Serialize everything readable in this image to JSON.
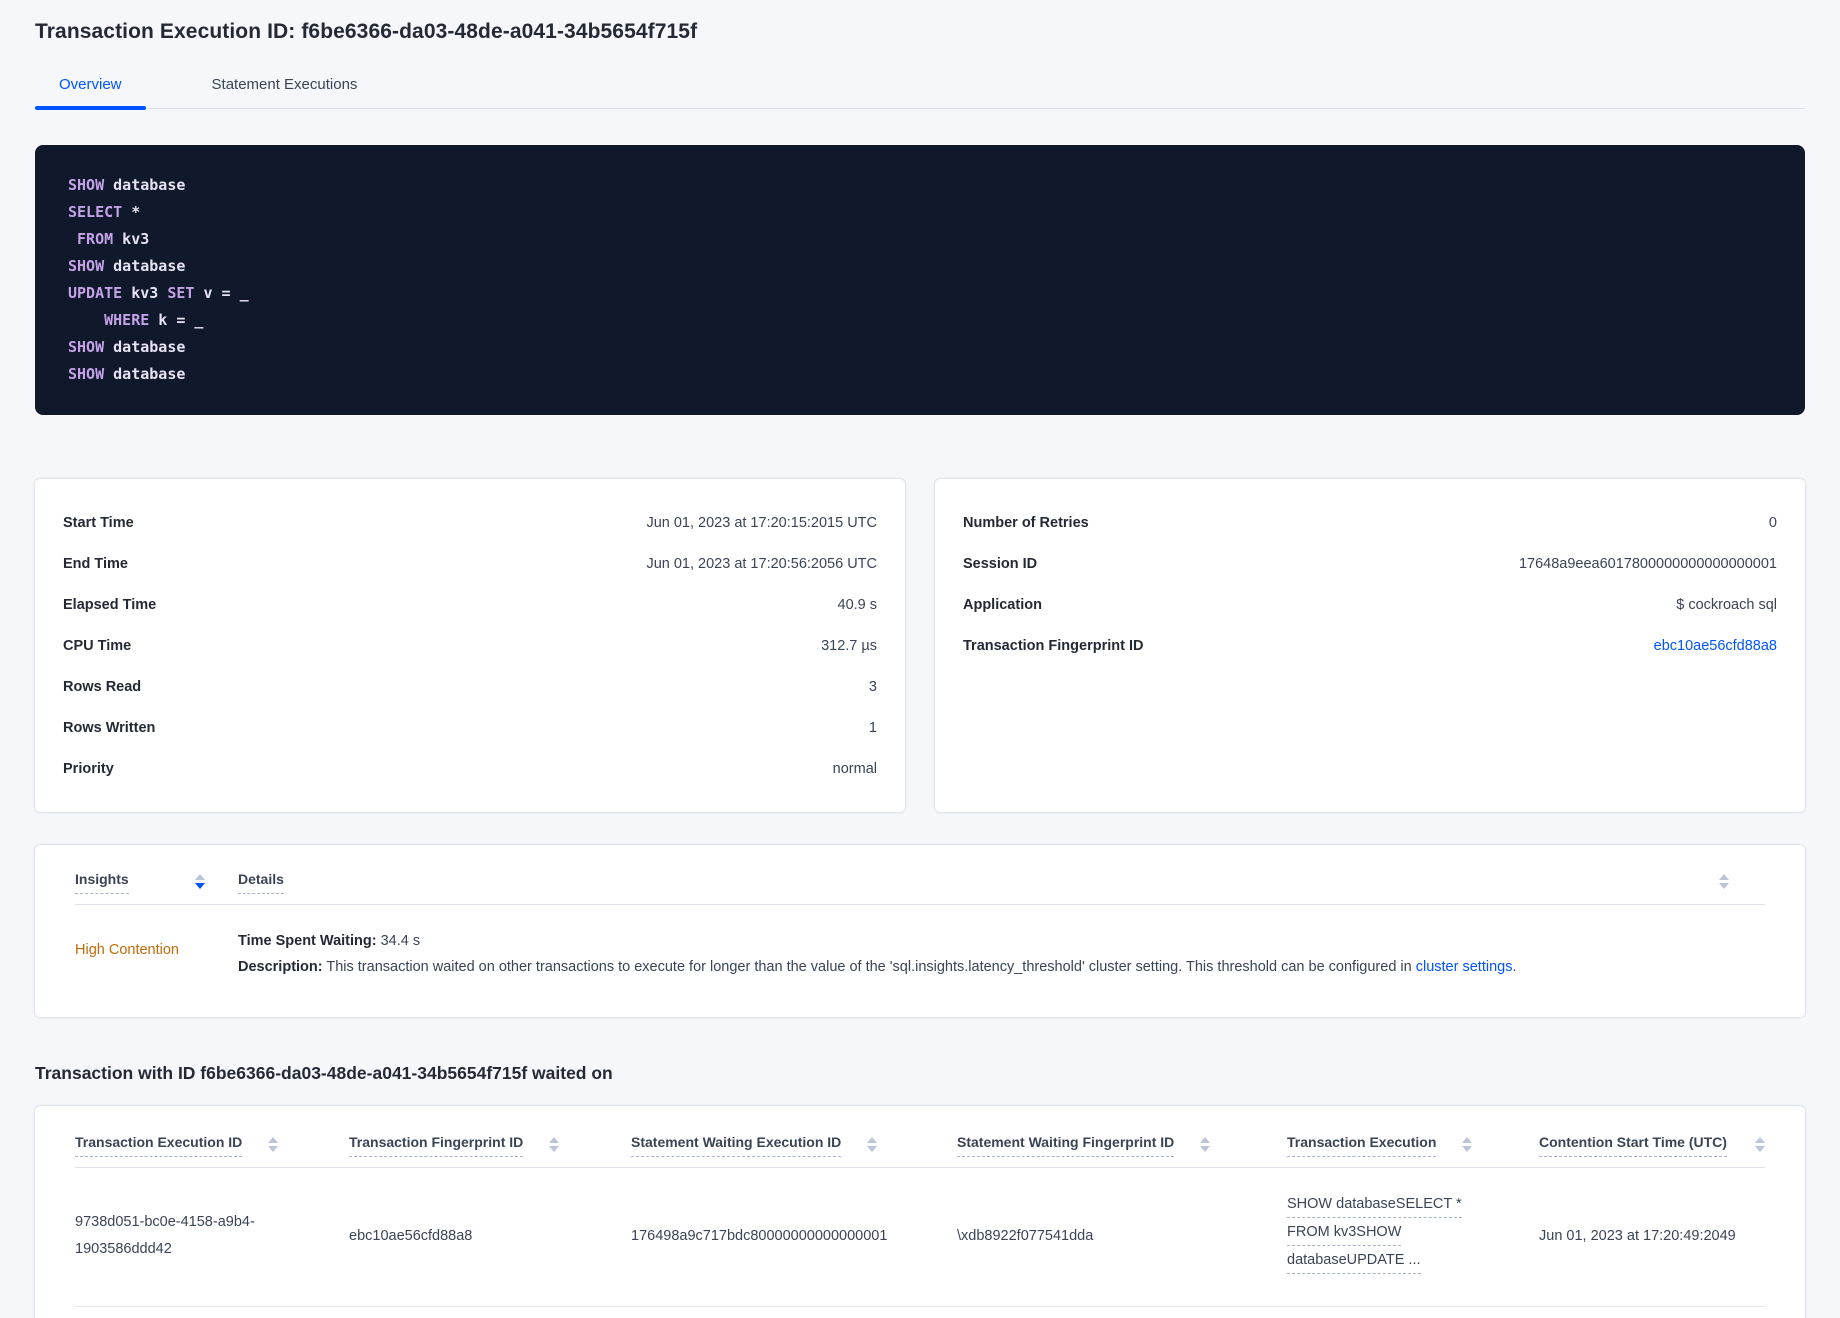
{
  "page": {
    "title": "Transaction Execution ID: f6be6366-da03-48de-a041-34b5654f715f",
    "background_color": "#f5f7fa",
    "accent_blue": "#0055ff",
    "contention_orange": "#bf6b09",
    "sql_box_background": "#10192c",
    "sql_keyword_color": "#c5a2e8",
    "sql_text_color": "#e7e3f2"
  },
  "tabs": [
    {
      "label": "Overview",
      "active": true
    },
    {
      "label": "Statement Executions",
      "active": false
    }
  ],
  "sql_box": {
    "lines": [
      [
        {
          "k": true,
          "t": "SHOW"
        },
        {
          "k": false,
          "t": " database"
        }
      ],
      [
        {
          "k": true,
          "t": "SELECT"
        },
        {
          "k": false,
          "t": " *"
        }
      ],
      [
        {
          "k": false,
          "t": " "
        },
        {
          "k": true,
          "t": "FROM"
        },
        {
          "k": false,
          "t": " kv3"
        }
      ],
      [
        {
          "k": true,
          "t": "SHOW"
        },
        {
          "k": false,
          "t": " database"
        }
      ],
      [
        {
          "k": true,
          "t": "UPDATE"
        },
        {
          "k": false,
          "t": " kv3 "
        },
        {
          "k": true,
          "t": "SET"
        },
        {
          "k": false,
          "t": " v = _"
        }
      ],
      [
        {
          "k": false,
          "t": "    "
        },
        {
          "k": true,
          "t": "WHERE"
        },
        {
          "k": false,
          "t": " k = _"
        }
      ],
      [
        {
          "k": true,
          "t": "SHOW"
        },
        {
          "k": false,
          "t": " database"
        }
      ],
      [
        {
          "k": true,
          "t": "SHOW"
        },
        {
          "k": false,
          "t": " database"
        }
      ]
    ]
  },
  "left_card": {
    "rows": [
      {
        "label": "Start Time",
        "value": "Jun 01, 2023 at 17:20:15:2015 UTC"
      },
      {
        "label": "End Time",
        "value": "Jun 01, 2023 at 17:20:56:2056 UTC"
      },
      {
        "label": "Elapsed Time",
        "value": "40.9 s"
      },
      {
        "label": "CPU Time",
        "value": "312.7 µs"
      },
      {
        "label": "Rows Read",
        "value": "3"
      },
      {
        "label": "Rows Written",
        "value": "1"
      },
      {
        "label": "Priority",
        "value": "normal"
      }
    ]
  },
  "right_card": {
    "rows": [
      {
        "label": "Number of Retries",
        "value": "0"
      },
      {
        "label": "Session ID",
        "value": "17648a9eea6017800000000000000001"
      },
      {
        "label": "Application",
        "value": "$ cockroach sql"
      },
      {
        "label": "Transaction Fingerprint ID",
        "value": "ebc10ae56cfd88a8"
      }
    ]
  },
  "insights_table": {
    "headers": [
      {
        "label": "Insights"
      },
      {
        "label": "Details"
      }
    ],
    "row": {
      "insight": "High Contention",
      "waiting_label": "Time Spent Waiting:",
      "waiting_value": " 34.4 s",
      "description_label": "Description:",
      "description_text": " This transaction waited on other transactions to execute for longer than the value of the 'sql.insights.latency_threshold' cluster setting. This threshold can be configured in ",
      "description_link": "cluster settings",
      "description_end": "."
    }
  },
  "waited_section": {
    "heading": "Transaction with ID f6be6366-da03-48de-a041-34b5654f715f waited on",
    "headers": [
      "Transaction Execution ID",
      "Transaction Fingerprint ID",
      "Statement Waiting Execution ID",
      "Statement Waiting Fingerprint ID",
      "Transaction Execution",
      "Contention Start Time (UTC)"
    ],
    "row": {
      "transaction_execution_id": "9738d051-bc0e-4158-a9b4-1903586ddd42",
      "transaction_fingerprint_id": "ebc10ae56cfd88a8",
      "statement_waiting_execution_id": "176498a9c717bdc80000000000000001",
      "statement_waiting_fingerprint_id": "\\xdb8922f077541dda",
      "transaction_execution_lines": [
        "SHOW databaseSELECT *",
        "FROM kv3SHOW",
        "databaseUPDATE ..."
      ],
      "contention_start_time": "Jun 01, 2023 at 17:20:49:2049"
    }
  }
}
